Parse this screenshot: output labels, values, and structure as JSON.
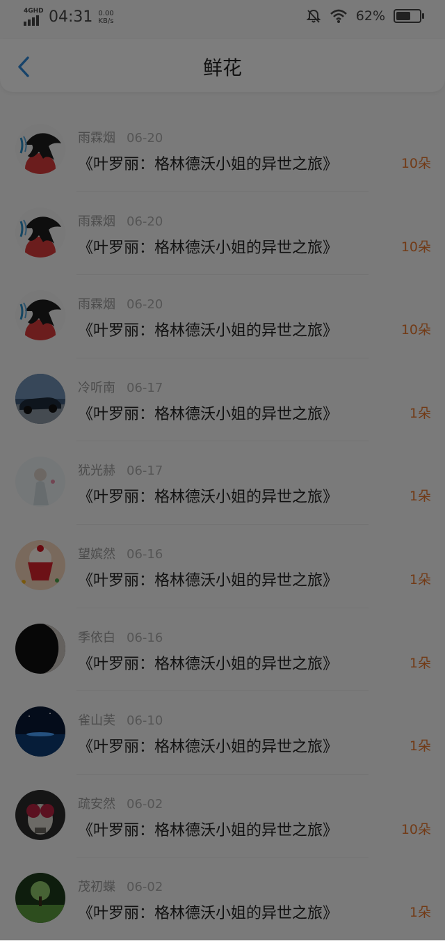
{
  "status_bar": {
    "network": "4GHD",
    "time": "04:31",
    "speed_value": "0.00",
    "speed_unit": "KB/s",
    "battery_pct": "62%",
    "battery_level": 0.62
  },
  "nav": {
    "title": "鲜花",
    "back_icon": "chevron-left-icon"
  },
  "colors": {
    "accent_blue": "#2f86d4",
    "count_orange": "#e5762f",
    "overlay": "rgba(0,0,0,0.5)"
  },
  "items": [
    {
      "name": "雨霖烟",
      "date": "06-20",
      "book": "《叶罗丽：格林德沃小姐的异世之旅》",
      "count": "10朵",
      "avatar": "ink-figure-avatar"
    },
    {
      "name": "雨霖烟",
      "date": "06-20",
      "book": "《叶罗丽：格林德沃小姐的异世之旅》",
      "count": "10朵",
      "avatar": "ink-figure-avatar"
    },
    {
      "name": "雨霖烟",
      "date": "06-20",
      "book": "《叶罗丽：格林德沃小姐的异世之旅》",
      "count": "10朵",
      "avatar": "ink-figure-avatar"
    },
    {
      "name": "冷听南",
      "date": "06-17",
      "book": "《叶罗丽：格林德沃小姐的异世之旅》",
      "count": "1朵",
      "avatar": "car-avatar"
    },
    {
      "name": "犹光赫",
      "date": "06-17",
      "book": "《叶罗丽：格林德沃小姐的异世之旅》",
      "count": "1朵",
      "avatar": "girl-avatar"
    },
    {
      "name": "望嫔然",
      "date": "06-16",
      "book": "《叶罗丽：格林德沃小姐的异世之旅》",
      "count": "1朵",
      "avatar": "cupcake-avatar"
    },
    {
      "name": "季依白",
      "date": "06-16",
      "book": "《叶罗丽：格林德沃小姐的异世之旅》",
      "count": "1朵",
      "avatar": "dark-portrait-avatar"
    },
    {
      "name": "雀山芙",
      "date": "06-10",
      "book": "《叶罗丽：格林德沃小姐的异世之旅》",
      "count": "1朵",
      "avatar": "night-sea-avatar"
    },
    {
      "name": "疏安然",
      "date": "06-02",
      "book": "《叶罗丽：格林德沃小姐的异世之旅》",
      "count": "10朵",
      "avatar": "skull-roses-avatar"
    },
    {
      "name": "茂初蝶",
      "date": "06-02",
      "book": "《叶罗丽：格林德沃小姐的异世之旅》",
      "count": "1朵",
      "avatar": "tree-avatar"
    }
  ]
}
